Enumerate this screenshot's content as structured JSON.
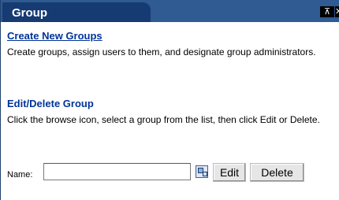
{
  "portlet": {
    "title": "Group",
    "pin_glyph": "⊼",
    "close_glyph": "✕"
  },
  "create": {
    "heading": "Create New Groups",
    "description": "Create groups, assign users to them, and designate group administrators."
  },
  "edit_delete": {
    "heading": "Edit/Delete Group",
    "description": "Click the browse icon, select a group from the list, then click Edit or Delete."
  },
  "form": {
    "name_label": "Name:",
    "name_value": "",
    "edit_label": "Edit",
    "delete_label": "Delete",
    "browse_icon": "browse-icon"
  },
  "colors": {
    "title_bar": "#2f5a92",
    "title_tab": "#163a72",
    "link": "#003399"
  }
}
